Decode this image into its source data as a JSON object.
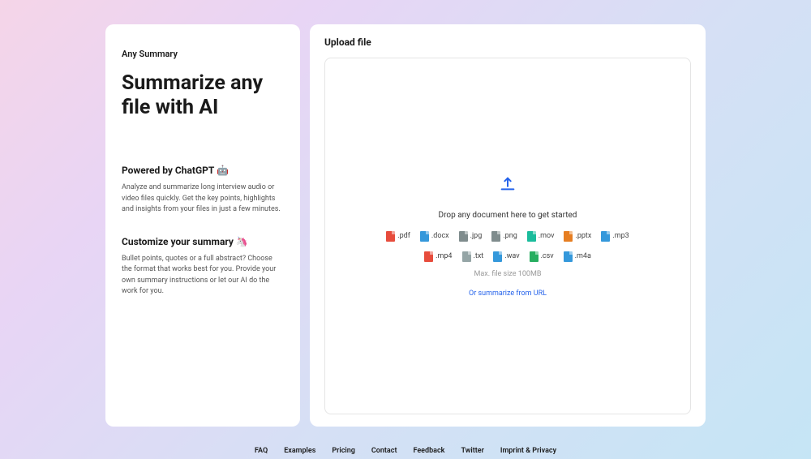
{
  "left": {
    "brand": "Any Summary",
    "heroTitle": "Summarize any file with AI",
    "section1": {
      "title": "Powered by ChatGPT 🤖",
      "text": "Analyze and summarize long interview audio or video files quickly. Get the key points, highlights and insights from your files in just a few minutes."
    },
    "section2": {
      "title": "Customize your summary 🦄",
      "text": "Bullet points, quotes or a full abstract? Choose the format that works best for you. Provide your own summary instructions or let our AI do the work for you."
    }
  },
  "right": {
    "title": "Upload file",
    "dropText": "Drop any document here to get started",
    "fileTypes": [
      {
        "label": ".pdf",
        "color": "#e74c3c"
      },
      {
        "label": ".docx",
        "color": "#3498db"
      },
      {
        "label": ".jpg",
        "color": "#7f8c8d"
      },
      {
        "label": ".png",
        "color": "#7f8c8d"
      },
      {
        "label": ".mov",
        "color": "#1abc9c"
      },
      {
        "label": ".pptx",
        "color": "#e67e22"
      },
      {
        "label": ".mp3",
        "color": "#3498db"
      },
      {
        "label": ".mp4",
        "color": "#e74c3c"
      },
      {
        "label": ".txt",
        "color": "#95a5a6"
      },
      {
        "label": ".wav",
        "color": "#3498db"
      },
      {
        "label": ".csv",
        "color": "#27ae60"
      },
      {
        "label": ".m4a",
        "color": "#3498db"
      }
    ],
    "maxSize": "Max. file size 100MB",
    "urlLink": "Or summarize from URL"
  },
  "footer": [
    "FAQ",
    "Examples",
    "Pricing",
    "Contact",
    "Feedback",
    "Twitter",
    "Imprint & Privacy"
  ]
}
